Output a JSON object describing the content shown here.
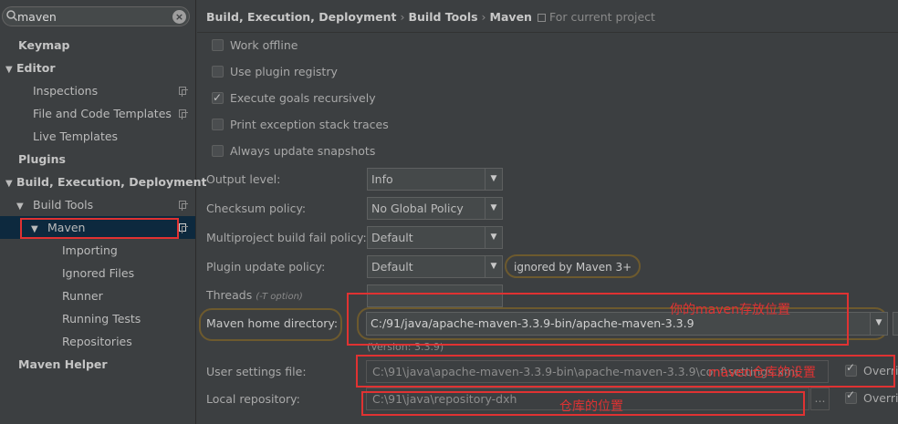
{
  "search": {
    "value": "maven"
  },
  "sidebar": {
    "items": [
      {
        "label": "Keymap"
      },
      {
        "label": "Editor"
      },
      {
        "label": "Inspections"
      },
      {
        "label": "File and Code Templates"
      },
      {
        "label": "Live Templates"
      },
      {
        "label": "Plugins"
      },
      {
        "label": "Build, Execution, Deployment"
      },
      {
        "label": "Build Tools"
      },
      {
        "label": "Maven"
      },
      {
        "label": "Importing"
      },
      {
        "label": "Ignored Files"
      },
      {
        "label": "Runner"
      },
      {
        "label": "Running Tests"
      },
      {
        "label": "Repositories"
      },
      {
        "label": "Maven Helper"
      }
    ]
  },
  "breadcrumb": {
    "p1": "Build, Execution, Deployment",
    "p2": "Build Tools",
    "p3": "Maven",
    "scope": "For current project"
  },
  "checkboxes": [
    {
      "label": "Work offline",
      "checked": false
    },
    {
      "label": "Use plugin registry",
      "checked": false
    },
    {
      "label": "Execute goals recursively",
      "checked": true
    },
    {
      "label": "Print exception stack traces",
      "checked": false
    },
    {
      "label": "Always update snapshots",
      "checked": false
    }
  ],
  "settings": {
    "output_level_label": "Output level:",
    "output_level_value": "Info",
    "checksum_label": "Checksum policy:",
    "checksum_value": "No Global Policy",
    "multiproject_label": "Multiproject build fail policy:",
    "multiproject_value": "Default",
    "plugin_update_label": "Plugin update policy:",
    "plugin_update_value": "Default",
    "plugin_update_note": "ignored by Maven 3+",
    "threads_label": "Threads",
    "threads_hint": "(-T option)",
    "maven_home_label": "Maven home directory:",
    "maven_home_value": "C:/91/java/apache-maven-3.3.9-bin/apache-maven-3.3.9",
    "version_text": "(Version: 3.3.9)",
    "user_settings_label": "User settings file:",
    "user_settings_value": "C:\\91\\java\\apache-maven-3.3.9-bin\\apache-maven-3.3.9\\conf\\settings.xml",
    "local_repo_label": "Local repository:",
    "local_repo_value": "C:\\91\\java\\repository-dxh",
    "override_label": "Override",
    "browse_label": "..."
  },
  "annotations": {
    "home": "你的maven存放位置",
    "settings": "maven仓库的设置",
    "repo": "仓库的位置"
  }
}
